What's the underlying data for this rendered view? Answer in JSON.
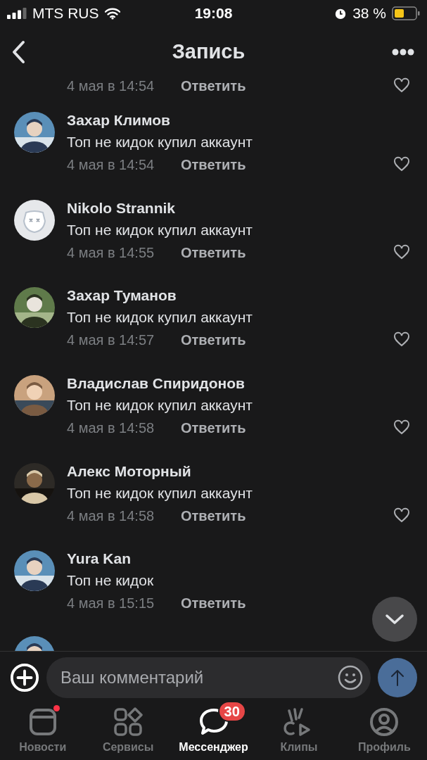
{
  "status_bar": {
    "carrier": "MTS RUS",
    "time": "19:08",
    "battery": "38 %"
  },
  "header": {
    "title": "Запись"
  },
  "partial_comment": {
    "date": "4 мая в 14:54",
    "reply": "Ответить",
    "liked": false
  },
  "comments": [
    {
      "author": "Захар Климов",
      "text": "Топ не кидок купил аккаунт",
      "date": "4 мая в 14:54",
      "reply": "Ответить",
      "liked": false
    },
    {
      "author": "Nikolo Strannik",
      "text": "Топ не кидок купил аккаунт",
      "date": "4 мая в 14:55",
      "reply": "Ответить",
      "liked": false,
      "avatar": {
        "kind": "default"
      }
    },
    {
      "author": "Захар Туманов",
      "text": "Топ не кидок купил аккаунт",
      "date": "4 мая в 14:57",
      "reply": "Ответить",
      "liked": false
    },
    {
      "author": "Владислав Спиридонов",
      "text": "Топ не кидок купил аккаунт",
      "date": "4 мая в 14:58",
      "reply": "Ответить",
      "liked": false
    },
    {
      "author": "Алекс Моторный",
      "text": "Топ не кидок купил аккаунт",
      "date": "4 мая в 14:58",
      "reply": "Ответить",
      "liked": false
    },
    {
      "author": "Yura Kan",
      "text": "Топ не кидок",
      "date": "4 мая в 15:15",
      "reply": "Ответить"
    }
  ],
  "composer": {
    "placeholder": "Ваш комментарий"
  },
  "tabs": [
    {
      "label": "Новости",
      "selected": false,
      "kind": "news",
      "dot": true
    },
    {
      "label": "Сервисы",
      "selected": false,
      "kind": "services"
    },
    {
      "label": "Мессенджер",
      "selected": true,
      "kind": "messenger",
      "badge": "30"
    },
    {
      "label": "Клипы",
      "selected": false,
      "kind": "clips"
    },
    {
      "label": "Профиль",
      "selected": false,
      "kind": "profile"
    }
  ]
}
